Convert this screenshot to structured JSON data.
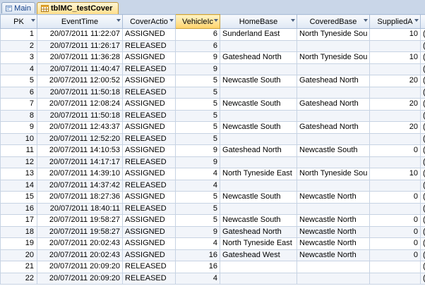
{
  "tabs": [
    {
      "label": "Main",
      "icon": "form-icon"
    },
    {
      "label": "tblMC_testCover",
      "icon": "table-icon"
    }
  ],
  "grid": {
    "columns": [
      "PK",
      "EventTime",
      "CoverActio",
      "VehicleIc",
      "HomeBase",
      "CoveredBase",
      "SuppliedA",
      ""
    ],
    "selected_column": "VehicleIc",
    "rows": [
      [
        "1",
        "20/07/2011 11:22:07",
        "ASSIGNED",
        "6",
        "Sunderland East",
        "North Tyneside Sou",
        "10",
        "("
      ],
      [
        "2",
        "20/07/2011 11:26:17",
        "RELEASED",
        "6",
        "",
        "",
        "",
        "("
      ],
      [
        "3",
        "20/07/2011 11:36:28",
        "ASSIGNED",
        "9",
        "Gateshead North",
        "North Tyneside Sou",
        "10",
        "("
      ],
      [
        "4",
        "20/07/2011 11:40:47",
        "RELEASED",
        "9",
        "",
        "",
        "",
        "("
      ],
      [
        "5",
        "20/07/2011 12:00:52",
        "ASSIGNED",
        "5",
        "Newcastle South",
        "Gateshead North",
        "20",
        "("
      ],
      [
        "6",
        "20/07/2011 11:50:18",
        "RELEASED",
        "5",
        "",
        "",
        "",
        "("
      ],
      [
        "7",
        "20/07/2011 12:08:24",
        "ASSIGNED",
        "5",
        "Newcastle South",
        "Gateshead North",
        "20",
        "("
      ],
      [
        "8",
        "20/07/2011 11:50:18",
        "RELEASED",
        "5",
        "",
        "",
        "",
        "("
      ],
      [
        "9",
        "20/07/2011 12:43:37",
        "ASSIGNED",
        "5",
        "Newcastle South",
        "Gateshead North",
        "20",
        "("
      ],
      [
        "10",
        "20/07/2011 12:52:20",
        "RELEASED",
        "5",
        "",
        "",
        "",
        "("
      ],
      [
        "11",
        "20/07/2011 14:10:53",
        "ASSIGNED",
        "9",
        "Gateshead North",
        "Newcastle South",
        "0",
        "("
      ],
      [
        "12",
        "20/07/2011 14:17:17",
        "RELEASED",
        "9",
        "",
        "",
        "",
        "("
      ],
      [
        "13",
        "20/07/2011 14:39:10",
        "ASSIGNED",
        "4",
        "North Tyneside East",
        "North Tyneside Sou",
        "10",
        "("
      ],
      [
        "14",
        "20/07/2011 14:37:42",
        "RELEASED",
        "4",
        "",
        "",
        "",
        "("
      ],
      [
        "15",
        "20/07/2011 18:27:36",
        "ASSIGNED",
        "5",
        "Newcastle South",
        "Newcastle North",
        "0",
        "("
      ],
      [
        "16",
        "20/07/2011 18:40:11",
        "RELEASED",
        "5",
        "",
        "",
        "",
        "("
      ],
      [
        "17",
        "20/07/2011 19:58:27",
        "ASSIGNED",
        "5",
        "Newcastle South",
        "Newcastle North",
        "0",
        "("
      ],
      [
        "18",
        "20/07/2011 19:58:27",
        "ASSIGNED",
        "9",
        "Gateshead North",
        "Newcastle North",
        "0",
        "("
      ],
      [
        "19",
        "20/07/2011 20:02:43",
        "ASSIGNED",
        "4",
        "North Tyneside East",
        "Newcastle North",
        "0",
        "("
      ],
      [
        "20",
        "20/07/2011 20:02:43",
        "ASSIGNED",
        "16",
        "Gateshead West",
        "Newcastle North",
        "0",
        "("
      ],
      [
        "21",
        "20/07/2011 20:09:20",
        "RELEASED",
        "16",
        "",
        "",
        "",
        "("
      ],
      [
        "22",
        "20/07/2011 20:09:20",
        "RELEASED",
        "4",
        "",
        "",
        "",
        "("
      ]
    ]
  },
  "colors": {
    "accent": "#ffd36a",
    "header": "#dfe8f4",
    "tabbar": "#c9d6e8"
  }
}
